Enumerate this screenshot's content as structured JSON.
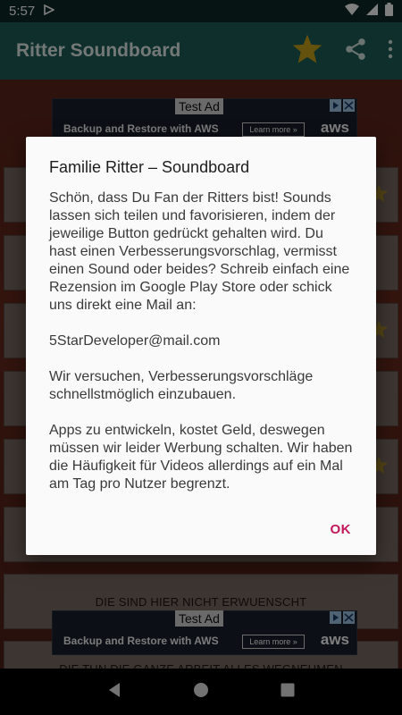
{
  "status_bar": {
    "time": "5:57"
  },
  "app_bar": {
    "title": "Ritter Soundboard",
    "star_color": "#c8a21a"
  },
  "rows": [
    {
      "label": ""
    },
    {
      "label": ""
    },
    {
      "label": ""
    },
    {
      "label": ""
    },
    {
      "label": ""
    },
    {
      "label": ""
    },
    {
      "label": ""
    },
    {
      "label": "DIE SIND HIER NICHT ERWUENSCHT"
    },
    {
      "label": "DIE TUN DIE GANZE ARBEIT ALLES WEGNEHMEN"
    }
  ],
  "ads": [
    {
      "label": "Test Ad",
      "headline": "Backup and Restore with AWS",
      "cta": "Learn more »",
      "brand": "aws"
    },
    {
      "label": "Test Ad",
      "headline": "Backup and Restore with AWS",
      "cta": "Learn more »",
      "brand": "aws"
    }
  ],
  "dialog": {
    "title": "Familie Ritter – Soundboard",
    "paragraphs": [
      "Schön, dass Du Fan der Ritters bist! Sounds lassen sich teilen und favorisieren, indem der jeweilige Button gedrückt gehalten wird. Du hast einen Verbesserungsvorschlag, vermisst einen Sound oder beides? Schreib einfach eine Rezension im Google Play Store oder schick uns direkt eine Mail an:",
      "5StarDeveloper@mail.com",
      "Wir versuchen, Verbesserungsvorschläge schnellstmöglich einzubauen.",
      "Apps zu entwickeln, kostet Geld, deswegen müssen wir leider Werbung schalten. Wir haben die Häufigkeit für Videos allerdings auf ein Mal am Tag pro Nutzer begrenzt."
    ],
    "ok_label": "OK",
    "accent": "#c2185b"
  }
}
